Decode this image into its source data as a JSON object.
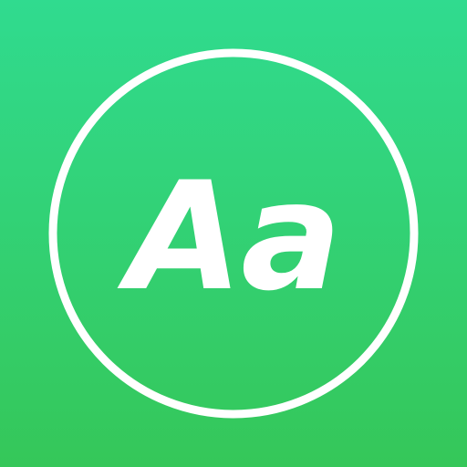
{
  "icon": {
    "glyph_text": "Aa",
    "icon_name": "font-size-icon",
    "colors": {
      "gradient_top": "#30DB8F",
      "gradient_bottom": "#35C759",
      "foreground": "#FFFFFF"
    }
  }
}
